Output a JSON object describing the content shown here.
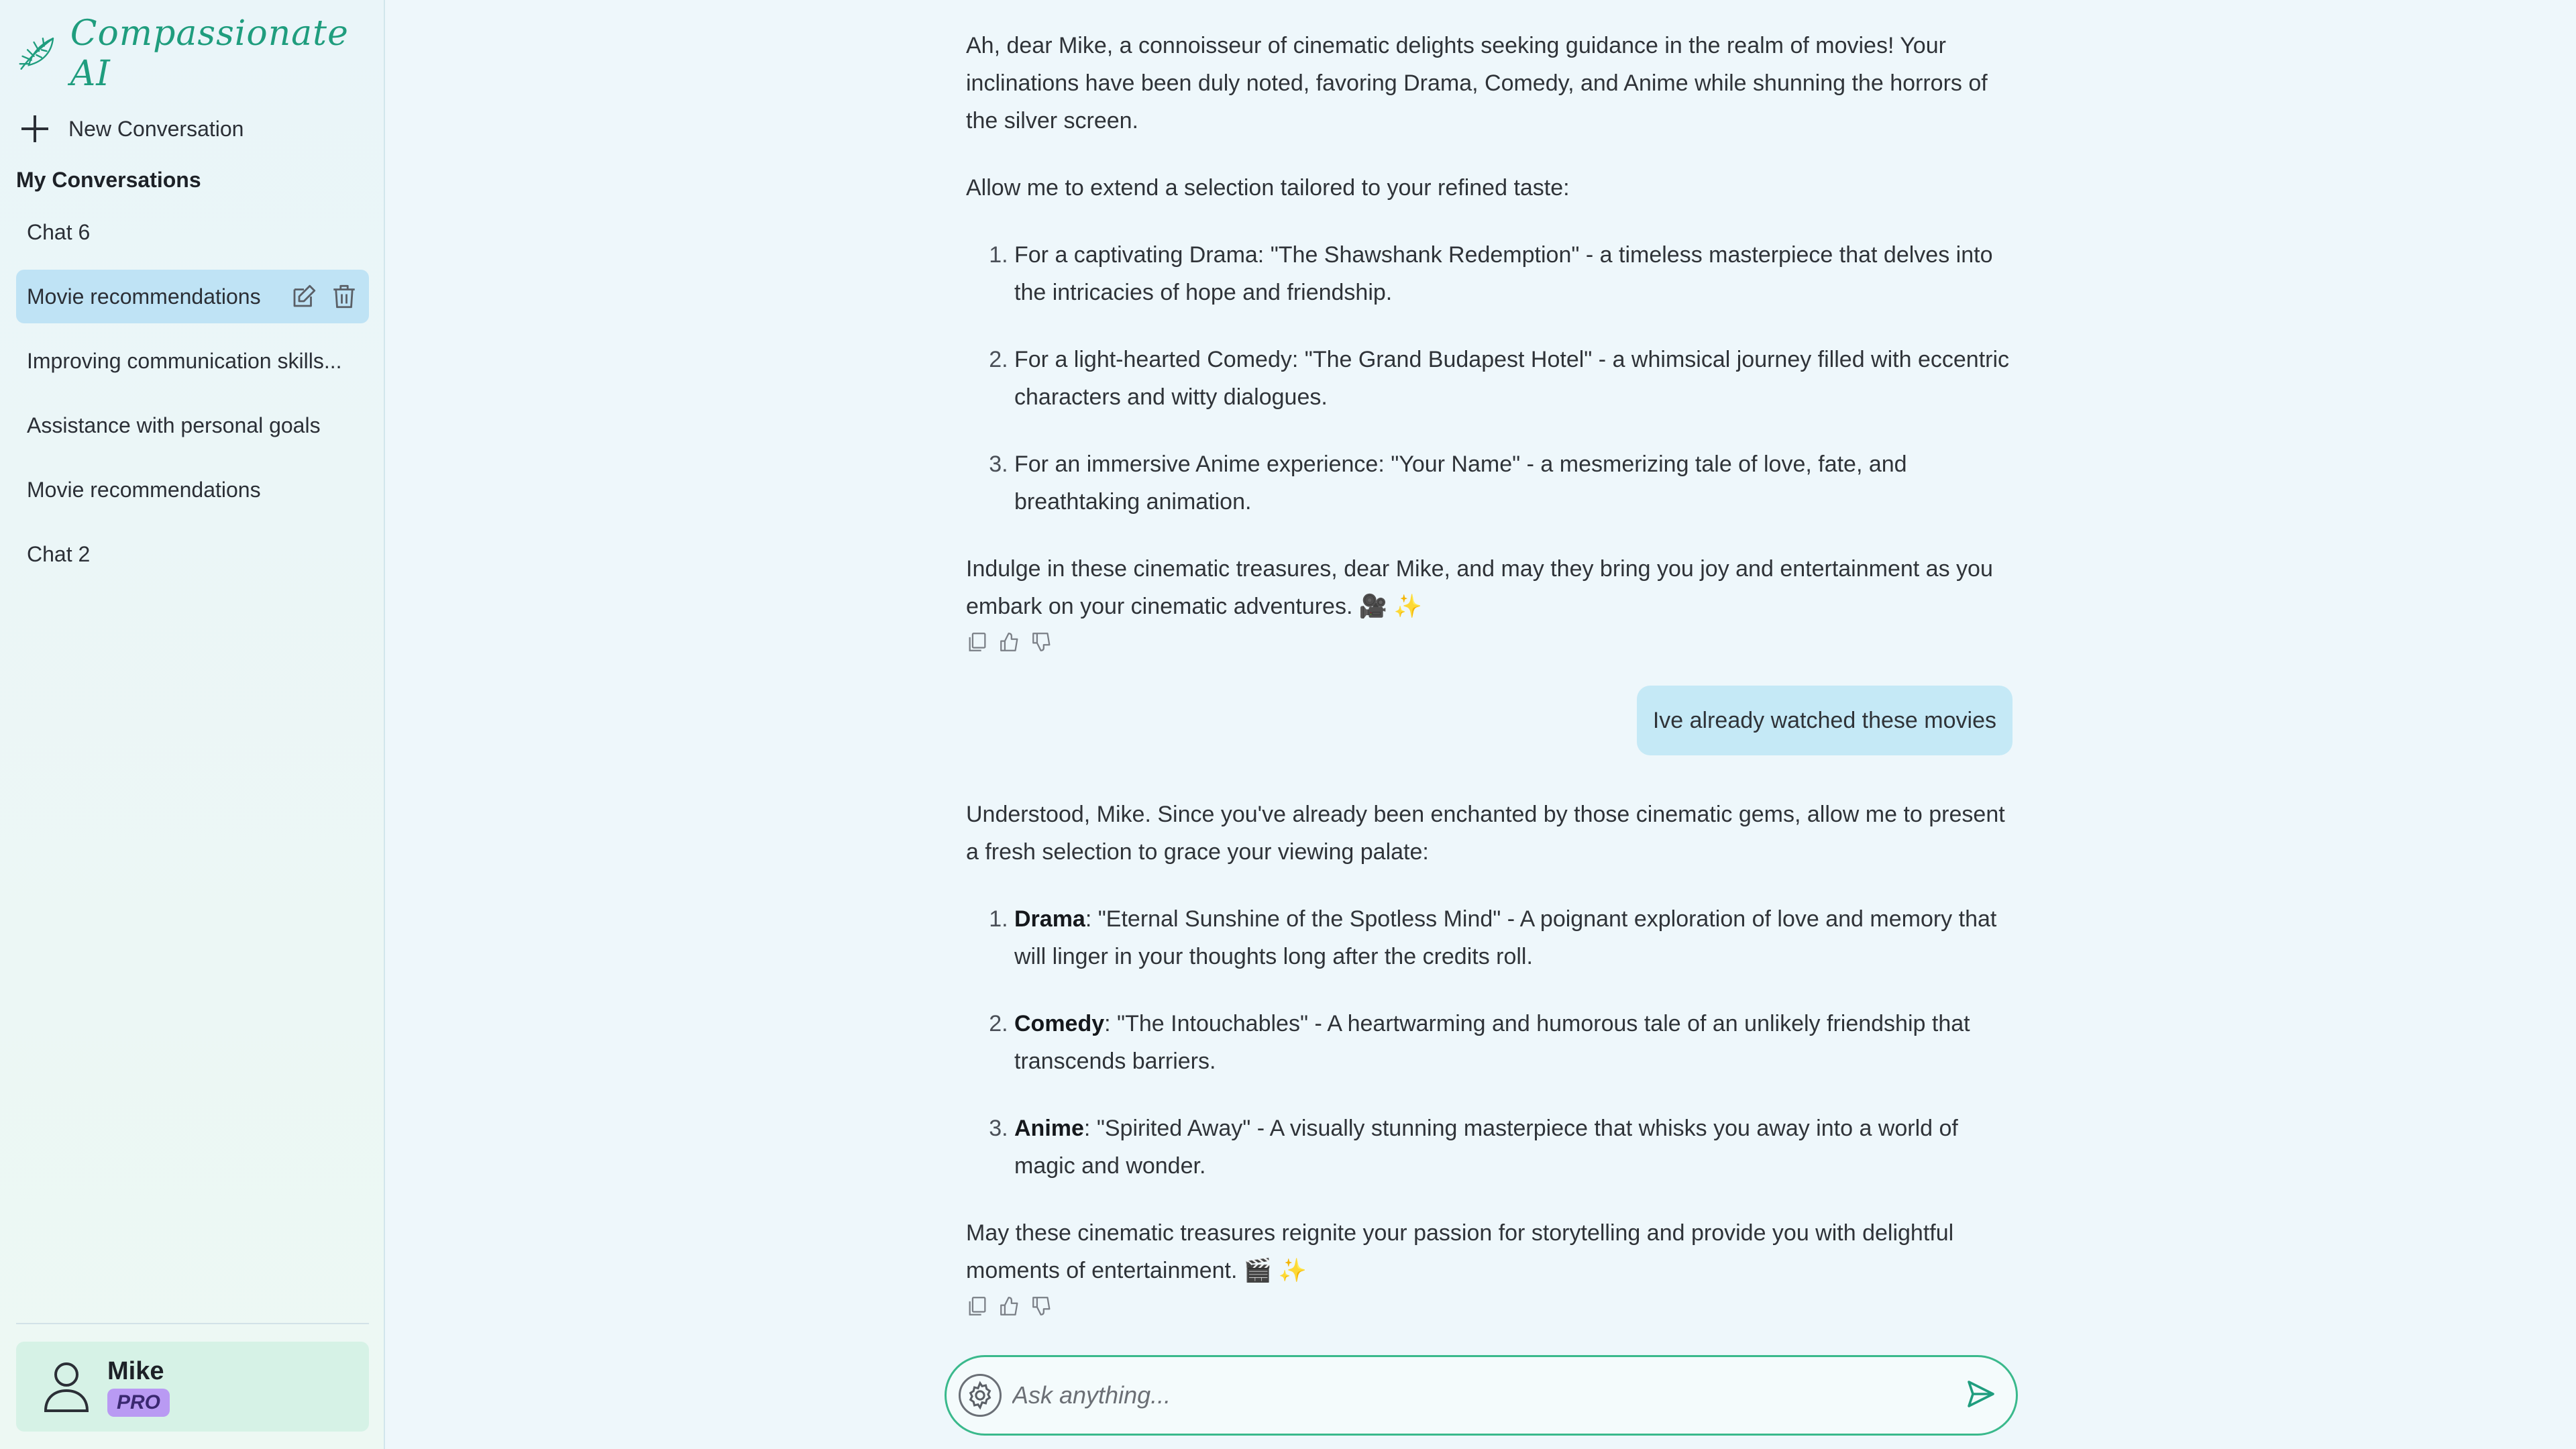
{
  "app": {
    "name": "Compassionate AI"
  },
  "sidebar": {
    "new_conversation": "New Conversation",
    "section_title": "My Conversations",
    "conversations": [
      {
        "label": "Chat 6",
        "active": false
      },
      {
        "label": "Movie recommendations",
        "active": true
      },
      {
        "label": "Improving communication skills...",
        "active": false
      },
      {
        "label": "Assistance with personal goals",
        "active": false
      },
      {
        "label": "Movie recommendations",
        "active": false
      },
      {
        "label": "Chat 2",
        "active": false
      }
    ],
    "user": {
      "name": "Mike",
      "badge": "PRO"
    }
  },
  "chat": {
    "assistant_1": {
      "intro": "Ah, dear Mike, a connoisseur of cinematic delights seeking guidance in the realm of movies! Your inclinations have been duly noted, favoring Drama, Comedy, and Anime while shunning the horrors of the silver screen.",
      "lead": "Allow me to extend a selection tailored to your refined taste:",
      "items": [
        "For a captivating Drama: \"The Shawshank Redemption\" - a timeless masterpiece that delves into the intricacies of hope and friendship.",
        "For a light-hearted Comedy: \"The Grand Budapest Hotel\" - a whimsical journey filled with eccentric characters and witty dialogues.",
        "For an immersive Anime experience: \"Your Name\" - a mesmerizing tale of love, fate, and breathtaking animation."
      ],
      "outro": "Indulge in these cinematic treasures, dear Mike, and may they bring you joy and entertainment as you embark on your cinematic adventures. 🎥 ✨"
    },
    "user_1": "Ive already watched these movies",
    "assistant_2": {
      "intro": "Understood, Mike. Since you've already been enchanted by those cinematic gems, allow me to present a fresh selection to grace your viewing palate:",
      "items": [
        {
          "genre": "Drama",
          "text": ": \"Eternal Sunshine of the Spotless Mind\" - A poignant exploration of love and memory that will linger in your thoughts long after the credits roll."
        },
        {
          "genre": "Comedy",
          "text": ": \"The Intouchables\" - A heartwarming and humorous tale of an unlikely friendship that transcends barriers."
        },
        {
          "genre": "Anime",
          "text": ": \"Spirited Away\" - A visually stunning masterpiece that whisks you away into a world of magic and wonder."
        }
      ],
      "outro": "May these cinematic treasures reignite your passion for storytelling and provide you with delightful moments of entertainment. 🎬 ✨"
    }
  },
  "composer": {
    "placeholder": "Ask anything..."
  },
  "icons": {
    "brand": "leaf-icon",
    "new": "plus-icon",
    "edit": "edit-icon",
    "delete": "trash-icon",
    "copy": "copy-icon",
    "like": "thumbs-up-icon",
    "dislike": "thumbs-down-icon",
    "user": "user-icon",
    "settings": "gear-icon",
    "send": "send-icon"
  },
  "colors": {
    "brand": "#1f9d7e",
    "active_item": "#bfe3f5",
    "user_card": "#d6f2e6",
    "pro_badge": "#b99af3",
    "user_bubble": "#c5e9f6",
    "composer_border": "#3ab98c"
  }
}
